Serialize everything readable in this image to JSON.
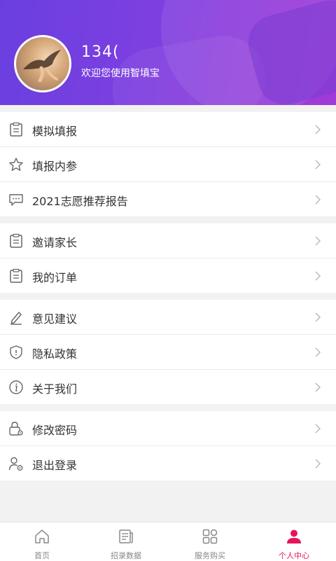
{
  "profile": {
    "phone": "134(",
    "welcome": "欢迎您使用智填宝"
  },
  "groups": [
    {
      "items": [
        {
          "label": "模拟填报",
          "icon": "clipboard-icon"
        },
        {
          "label": "填报内参",
          "icon": "star-icon"
        },
        {
          "label": "2021志愿推荐报告",
          "icon": "chat-icon"
        }
      ]
    },
    {
      "items": [
        {
          "label": "邀请家长",
          "icon": "clipboard-icon"
        },
        {
          "label": "我的订单",
          "icon": "clipboard-icon"
        }
      ]
    },
    {
      "items": [
        {
          "label": "意见建议",
          "icon": "pen-icon"
        },
        {
          "label": "隐私政策",
          "icon": "shield-icon"
        },
        {
          "label": "关于我们",
          "icon": "info-icon"
        }
      ]
    },
    {
      "items": [
        {
          "label": "修改密码",
          "icon": "lock-icon"
        },
        {
          "label": "退出登录",
          "icon": "user-gear-icon"
        }
      ]
    }
  ],
  "tabs": [
    {
      "label": "首页",
      "icon": "home-icon",
      "active": false
    },
    {
      "label": "招录数据",
      "icon": "document-icon",
      "active": false
    },
    {
      "label": "服务购买",
      "icon": "grid-icon",
      "active": false
    },
    {
      "label": "个人中心",
      "icon": "person-icon",
      "active": true
    }
  ],
  "colors": {
    "header_start": "#6a3fe0",
    "header_end": "#a23ad6",
    "active_tab": "#e6145a",
    "icon_gray": "#666666"
  }
}
